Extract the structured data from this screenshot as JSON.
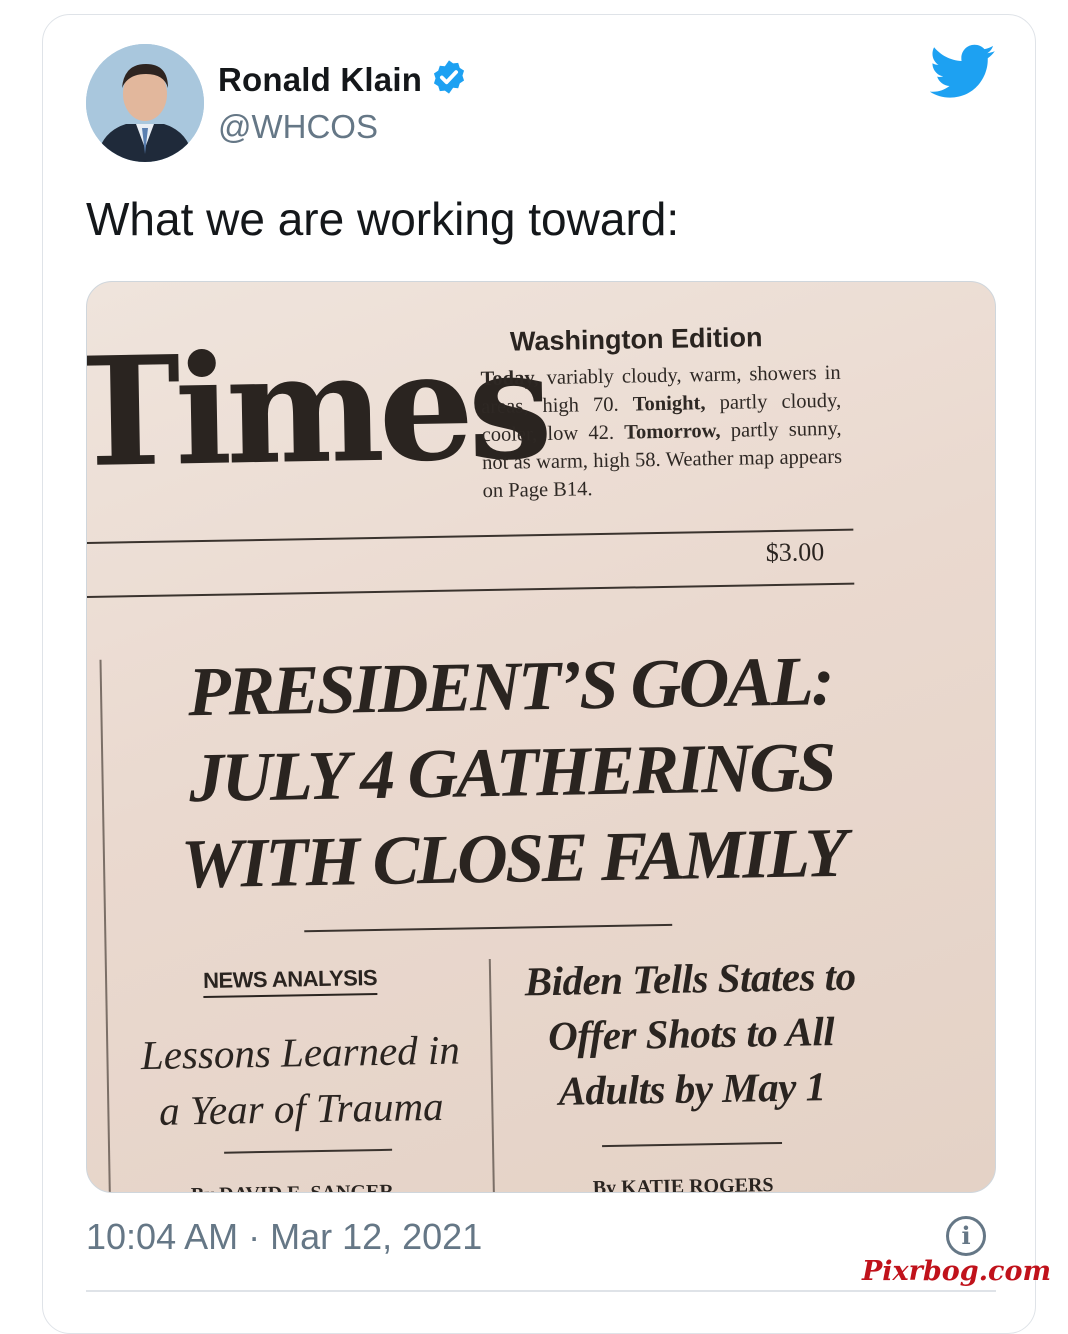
{
  "tweet": {
    "author_name": "Ronald Klain",
    "handle": "@WHCOS",
    "text": "What we are working toward:",
    "timestamp": "10:04 AM · Mar 12, 2021",
    "verified_color": "#1da1f2",
    "bird_color": "#1da1f2"
  },
  "newspaper": {
    "masthead": "Times",
    "edition": "Washington Edition",
    "weather": [
      {
        "text": "Today,",
        "bold": true
      },
      {
        "text": " variably cloudy, warm, showers in areas, high 70. ",
        "bold": false
      },
      {
        "text": "Tonight,",
        "bold": true
      },
      {
        "text": " partly cloudy, cooler, low 42. ",
        "bold": false
      },
      {
        "text": "Tomorrow,",
        "bold": true
      },
      {
        "text": " partly sunny, not as warm, high 58. Weather map appears on Page B14.",
        "bold": false
      }
    ],
    "price": "$3.00",
    "headline_lines": [
      "PRESIDENT’S GOAL:",
      "JULY 4 GATHERINGS",
      "WITH CLOSE FAMILY"
    ],
    "news_analysis_label": "NEWS ANALYSIS",
    "left_story_lines": [
      "Lessons Learned in",
      "a Year of Trauma"
    ],
    "left_byline": "By DAVID E. SANGER",
    "right_story_lines": [
      "Biden Tells States to",
      "Offer Shots to All",
      "Adults by May 1"
    ],
    "right_byline": "By KATIE ROGERS"
  },
  "watermark": "Pixrbog.com"
}
